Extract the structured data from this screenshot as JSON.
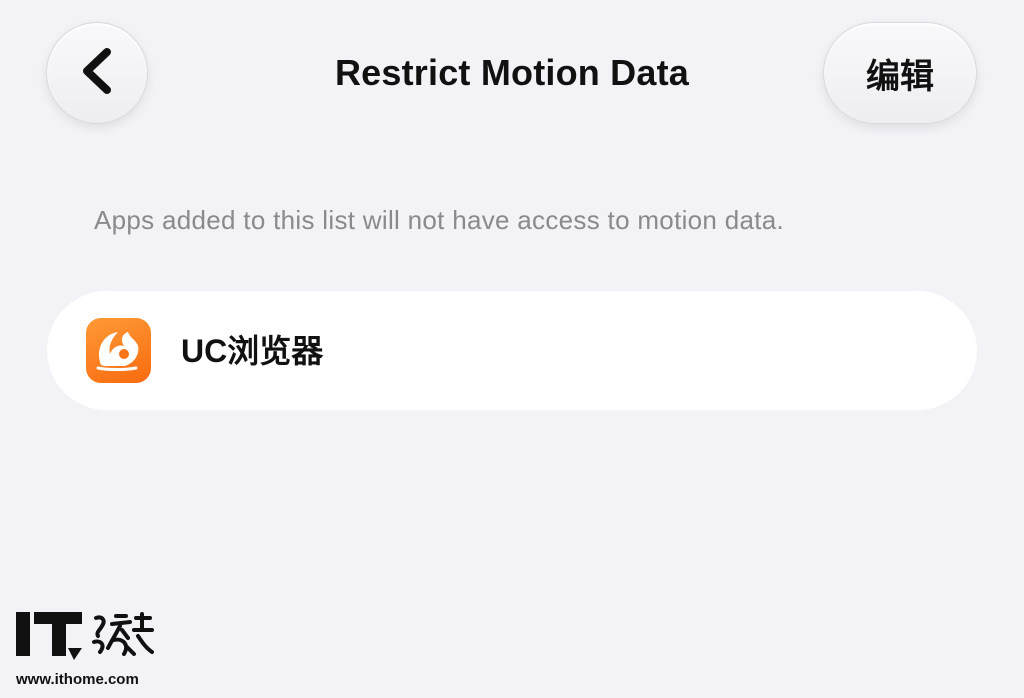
{
  "nav": {
    "title": "Restrict Motion Data",
    "back_icon": "chevron-left-icon",
    "edit_label": "编辑"
  },
  "description": "Apps added to this list will not have access to motion data.",
  "apps": [
    {
      "name": "UC浏览器",
      "icon": "uc-browser-app-icon",
      "icon_color": "#f7741a"
    }
  ],
  "watermark": {
    "url": "www.ithome.com"
  },
  "colors": {
    "background": "#f2f2f7",
    "card": "#ffffff",
    "secondary_text": "#8a8a8e"
  }
}
